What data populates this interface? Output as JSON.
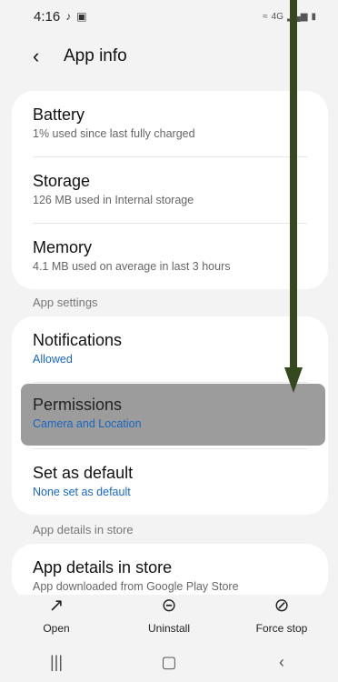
{
  "status_bar": {
    "time": "4:16",
    "left_icons": [
      "tiktok-icon",
      "gallery-icon"
    ],
    "right_text": "4G",
    "right_icons": [
      "wifi-icon",
      "signal-icon",
      "battery-icon"
    ]
  },
  "app_bar": {
    "title": "App info",
    "back_icon": "chevron-left-icon"
  },
  "usage": [
    {
      "title": "Battery",
      "subtitle": "1% used since last fully charged"
    },
    {
      "title": "Storage",
      "subtitle": "126 MB used in Internal storage"
    },
    {
      "title": "Memory",
      "subtitle": "4.1 MB used on average in last 3 hours"
    }
  ],
  "sections": {
    "app_settings": "App settings",
    "app_details": "App details in store"
  },
  "settings": [
    {
      "title": "Notifications",
      "subtitle": "Allowed"
    },
    {
      "title": "Permissions",
      "subtitle": "Camera and Location"
    },
    {
      "title": "Set as default",
      "subtitle": "None set as default"
    }
  ],
  "store": {
    "title": "App details in store",
    "subtitle": "App downloaded from Google Play Store"
  },
  "actions": [
    {
      "label": "Open",
      "icon": "open-external-icon"
    },
    {
      "label": "Uninstall",
      "icon": "uninstall-icon"
    },
    {
      "label": "Force stop",
      "icon": "force-stop-icon"
    }
  ],
  "nav": [
    "recent-apps-icon",
    "home-icon",
    "back-icon"
  ],
  "colors": {
    "accent": "#1767c4",
    "highlight": "#9c9c9c",
    "arrow": "#34491d",
    "background": "#f3f3f3"
  }
}
